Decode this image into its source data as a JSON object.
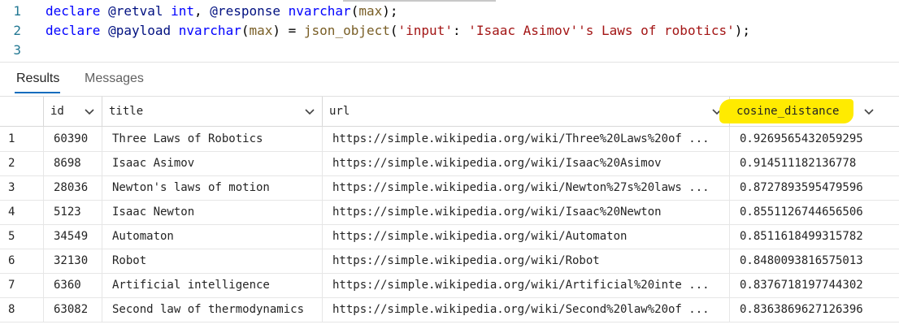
{
  "editor": {
    "lines": [
      {
        "number": "1",
        "parts": [
          {
            "t": "declare ",
            "c": "kw"
          },
          {
            "t": "@retval ",
            "c": "id"
          },
          {
            "t": "int",
            "c": "kw"
          },
          {
            "t": ", ",
            "c": ""
          },
          {
            "t": "@response ",
            "c": "id"
          },
          {
            "t": "nvarchar",
            "c": "kw"
          },
          {
            "t": "(",
            "c": ""
          },
          {
            "t": "max",
            "c": "fn"
          },
          {
            "t": ");",
            "c": ""
          }
        ]
      },
      {
        "number": "2",
        "parts": [
          {
            "t": "declare ",
            "c": "kw"
          },
          {
            "t": "@payload ",
            "c": "id"
          },
          {
            "t": "nvarchar",
            "c": "kw"
          },
          {
            "t": "(",
            "c": ""
          },
          {
            "t": "max",
            "c": "fn"
          },
          {
            "t": ") = ",
            "c": ""
          },
          {
            "t": "json_object",
            "c": "fn"
          },
          {
            "t": "(",
            "c": ""
          },
          {
            "t": "'input'",
            "c": "str"
          },
          {
            "t": ": ",
            "c": ""
          },
          {
            "t": "'Isaac Asimov''s Laws of robotics'",
            "c": "str"
          },
          {
            "t": ");",
            "c": ""
          }
        ]
      },
      {
        "number": "3",
        "parts": []
      }
    ]
  },
  "tabs": [
    {
      "label": "Results",
      "active": true
    },
    {
      "label": "Messages",
      "active": false
    }
  ],
  "grid": {
    "columns": [
      "id",
      "title",
      "url",
      "cosine_distance"
    ],
    "highlight_color": "#ffeb00",
    "rows": [
      {
        "n": "1",
        "id": "60390",
        "title": "Three Laws of Robotics",
        "url": "https://simple.wikipedia.org/wiki/Three%20Laws%20of ...",
        "dist": "0.9269565432059295"
      },
      {
        "n": "2",
        "id": "8698",
        "title": "Isaac Asimov",
        "url": "https://simple.wikipedia.org/wiki/Isaac%20Asimov",
        "dist": "0.914511182136778"
      },
      {
        "n": "3",
        "id": "28036",
        "title": "Newton's laws of motion",
        "url": "https://simple.wikipedia.org/wiki/Newton%27s%20laws ...",
        "dist": "0.8727893595479596"
      },
      {
        "n": "4",
        "id": "5123",
        "title": "Isaac Newton",
        "url": "https://simple.wikipedia.org/wiki/Isaac%20Newton",
        "dist": "0.8551126744656506"
      },
      {
        "n": "5",
        "id": "34549",
        "title": "Automaton",
        "url": "https://simple.wikipedia.org/wiki/Automaton",
        "dist": "0.8511618499315782"
      },
      {
        "n": "6",
        "id": "32130",
        "title": "Robot",
        "url": "https://simple.wikipedia.org/wiki/Robot",
        "dist": "0.8480093816575013"
      },
      {
        "n": "7",
        "id": "6360",
        "title": "Artificial intelligence",
        "url": "https://simple.wikipedia.org/wiki/Artificial%20inte ...",
        "dist": "0.8376718197744302"
      },
      {
        "n": "8",
        "id": "63082",
        "title": "Second law of thermodynamics",
        "url": "https://simple.wikipedia.org/wiki/Second%20law%20of ...",
        "dist": "0.8363869627126396"
      }
    ]
  }
}
